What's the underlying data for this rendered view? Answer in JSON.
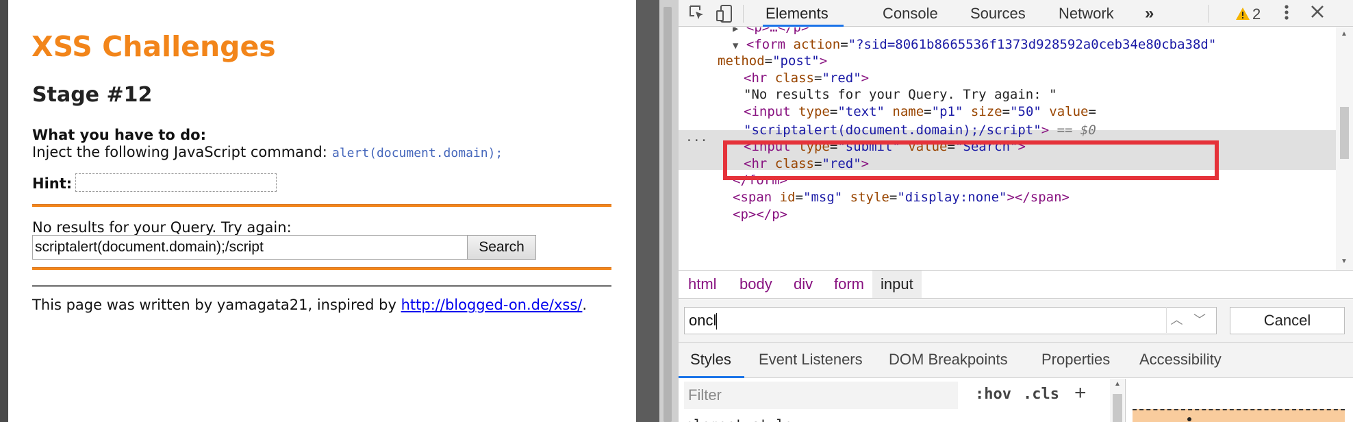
{
  "page": {
    "title": "XSS Challenges",
    "stage": "Stage #12",
    "todo_label": "What you have to do:",
    "todo_text": "Inject the following JavaScript command:",
    "todo_code": "alert(document.domain);",
    "hint_label": "Hint:",
    "noresult_text": "No results for your Query. Try again:",
    "query_value": "scriptalert(document.domain);/script",
    "search_button": "Search",
    "footer_text": "This page was written by yamagata21, inspired by",
    "footer_link": "http://blogged-on.de/xss/",
    "footer_end": "."
  },
  "devtools": {
    "tabs": [
      "Elements",
      "Console",
      "Sources",
      "Network"
    ],
    "more_tabs": "»",
    "warning_count": "2",
    "dom": {
      "l0": "<p>…</p>",
      "l1a": "<form",
      "l1b": "action",
      "l1c": "\"?sid=8061b8665536f1373d928592a0ceb34e80cba38d\"",
      "l2a": "method",
      "l2b": "\"post\"",
      "l3a": "<hr",
      "l3b": "class",
      "l3c": "\"red\"",
      "l4": "\"No results for your Query. Try again: \"",
      "l5a": "<input",
      "l5b": "type",
      "l5c": "\"text\"",
      "l5d": "name",
      "l5e": "\"p1\"",
      "l5f": "size",
      "l5g": "\"50\"",
      "l5h": "value",
      "l6a": "\"scriptalert(document.domain);/script\"",
      "l6b": "== $0",
      "l7a": "<input",
      "l7b": "type",
      "l7c": "\"submit\"",
      "l7d": "value",
      "l7e": "\"Search\"",
      "l8a": "<hr",
      "l8b": "class",
      "l8c": "\"red\"",
      "l9": "</form>",
      "l10a": "<span",
      "l10b": "id",
      "l10c": "\"msg\"",
      "l10d": "style",
      "l10e": "\"display:none\"",
      "l10f": "></span>",
      "l11": "<p></p>",
      "gutter_dots": "···"
    },
    "breadcrumb": [
      "html",
      "body",
      "div",
      "form",
      "input"
    ],
    "search_value": "oncl",
    "cancel_label": "Cancel",
    "style_tabs": [
      "Styles",
      "Event Listeners",
      "DOM Breakpoints",
      "Properties",
      "Accessibility"
    ],
    "filter_placeholder": "Filter",
    "hov_label": ":hov",
    "cls_label": ".cls",
    "plus_label": "+",
    "style_line": "element.style {"
  },
  "colors": {
    "accent_orange": "#f2851a",
    "highlight_red": "#e5323a",
    "devtools_blue": "#1a73e8"
  }
}
